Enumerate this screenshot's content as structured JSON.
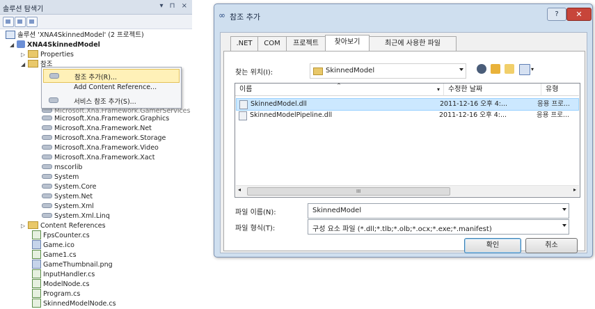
{
  "solution_explorer": {
    "title": "솔루션 탐색기",
    "title_controls": "▾ ⊓ ×",
    "solution": "솔루션 'XNA4SkinnedModel' (2 프로젝트)",
    "project": "XNA4SkinnedModel",
    "properties": "Properties",
    "references_folder": "참조",
    "references": [
      "Microsoft.Xna.Framework.GamerServices",
      "Microsoft.Xna.Framework.Graphics",
      "Microsoft.Xna.Framework.Net",
      "Microsoft.Xna.Framework.Storage",
      "Microsoft.Xna.Framework.Video",
      "Microsoft.Xna.Framework.Xact",
      "mscorlib",
      "System",
      "System.Core",
      "System.Net",
      "System.Xml",
      "System.Xml.Linq"
    ],
    "content_references": "Content References",
    "files": [
      "FpsCounter.cs",
      "Game.ico",
      "Game1.cs",
      "GameThumbnail.png",
      "InputHandler.cs",
      "ModelNode.cs",
      "Program.cs",
      "SkinnedModelNode.cs"
    ]
  },
  "context_menu": {
    "items": [
      "참조 추가(R)...",
      "Add Content Reference...",
      "서비스 참조 추가(S)..."
    ]
  },
  "dialog": {
    "title": "참조 추가",
    "help_label": "?",
    "close_label": "✕",
    "tabs": [
      ".NET",
      "COM",
      "프로젝트",
      "찾아보기",
      "최근에 사용한 파일"
    ],
    "look_in_label": "찾는 위치(I):",
    "look_in_value": "SkinnedModel",
    "columns": [
      "이름",
      "수정한 날짜",
      "유형"
    ],
    "files": [
      {
        "name": "SkinnedModel.dll",
        "date": "2011-12-16 오후 4:...",
        "type": "응용 프로..."
      },
      {
        "name": "SkinnedModelPipeline.dll",
        "date": "2011-12-16 오후 4:...",
        "type": "응용 프로..."
      }
    ],
    "scroll_grip": "III",
    "file_name_label": "파일 이름(N):",
    "file_name_value": "SkinnedModel",
    "file_type_label": "파일 형식(T):",
    "file_type_value": "구성 요소 파일 (*.dll;*.tlb;*.olb;*.ocx;*.exe;*.manifest)",
    "ok_label": "확인",
    "cancel_label": "취소"
  }
}
